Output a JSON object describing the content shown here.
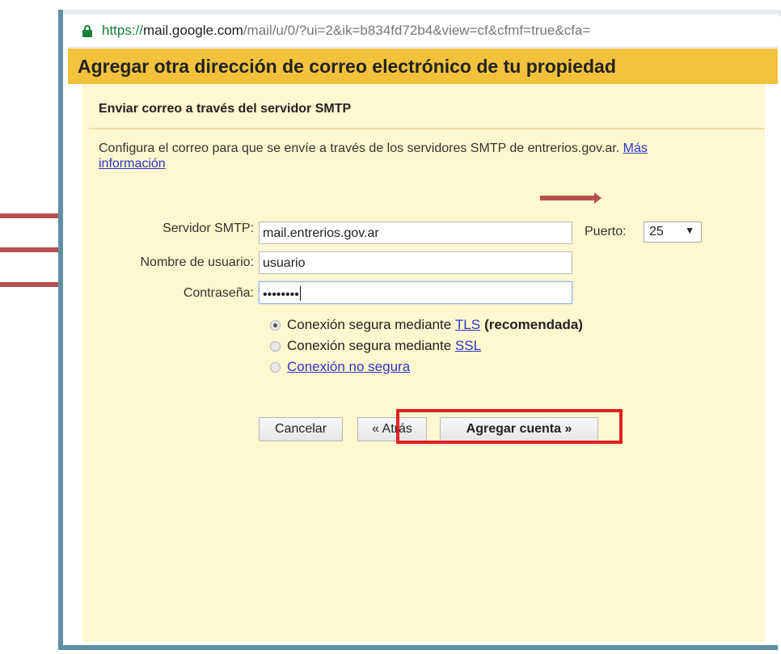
{
  "url": {
    "secure_part": "https://",
    "host": "mail.google.com",
    "path": "/mail/u/0/?ui=2&ik=b834fd72b4&view=cf&cfmf=true&cfa="
  },
  "dialog": {
    "title": "Agregar otra dirección de correo electrónico de tu propiedad",
    "subtitle": "Enviar correo a través del servidor SMTP",
    "intro_text": "Configura el correo para que se envíe a través de los servidores SMTP de entrerios.gov.ar.",
    "more_info_link": "Más información"
  },
  "form": {
    "smtp_label": "Servidor SMTP:",
    "smtp_value": "mail.entrerios.gov.ar",
    "username_label": "Nombre de usuario:",
    "username_value": "usuario",
    "password_label": "Contraseña:",
    "password_value": "••••••••",
    "port_label": "Puerto:",
    "port_value": "25"
  },
  "security_options": [
    {
      "prefix": "Conexión segura mediante ",
      "link": "TLS",
      "suffix": "(recomendada)",
      "checked": true
    },
    {
      "prefix": "Conexión segura mediante ",
      "link": "SSL",
      "suffix": "",
      "checked": false
    },
    {
      "prefix": "",
      "link": "Conexión no segura",
      "suffix": "",
      "checked": false
    }
  ],
  "buttons": {
    "cancel": "Cancelar",
    "back": "« Atrás",
    "add_account": "Agregar cuenta »"
  },
  "colors": {
    "header_bg": "#f2c23c",
    "content_bg": "#fff7cf",
    "annotation_red": "#e02020",
    "annotation_arrow": "#b5514e",
    "link": "#2a35c8"
  }
}
